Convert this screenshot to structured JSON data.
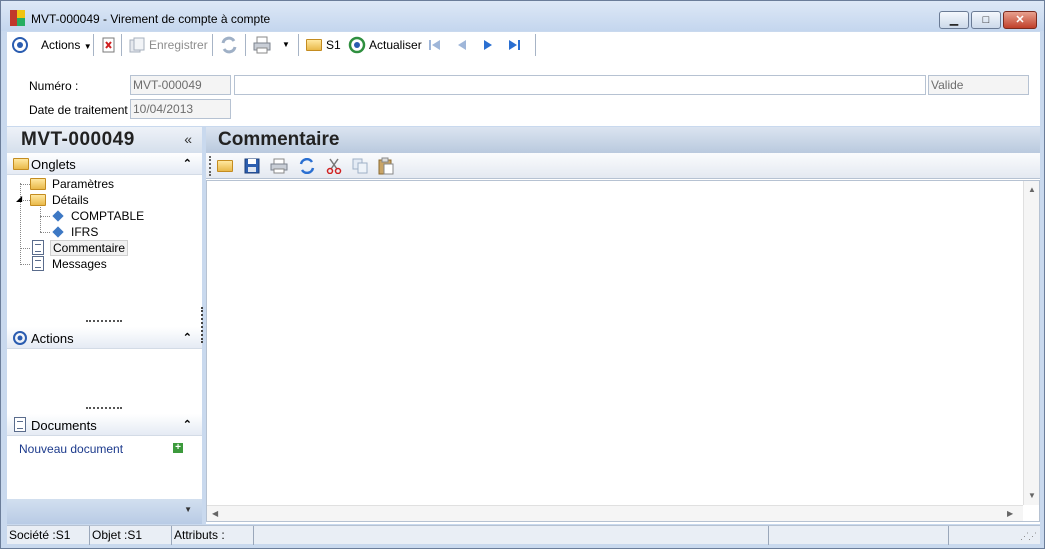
{
  "window": {
    "title": "MVT-000049 -  Virement de compte à compte",
    "minimize": "▁",
    "maximize": "□",
    "close": "✕"
  },
  "toolbar": {
    "actions_label": "Actions",
    "save_label": "Enregistrer",
    "s1_label": "S1",
    "refresh_label": "Actualiser"
  },
  "form": {
    "numero_label": "Numéro :",
    "numero_value": "MVT-000049",
    "description_value": "",
    "status_value": "Valide",
    "date_label": "Date de traitement :",
    "date_value": "10/04/2013"
  },
  "left_panel": {
    "title": "MVT-000049",
    "collapse": "«",
    "sections": {
      "onglets": "Onglets",
      "actions": "Actions",
      "documents": "Documents"
    },
    "tree": [
      {
        "label": "Paramètres"
      },
      {
        "label": "Détails"
      },
      {
        "label": "COMPTABLE"
      },
      {
        "label": "IFRS"
      },
      {
        "label": "Commentaire"
      },
      {
        "label": "Messages"
      }
    ],
    "new_document": "Nouveau document"
  },
  "right_panel": {
    "title": "Commentaire"
  },
  "status_bar": {
    "societe": "Société :S1",
    "objet": "Objet :S1",
    "attributs": "Attributs :"
  }
}
